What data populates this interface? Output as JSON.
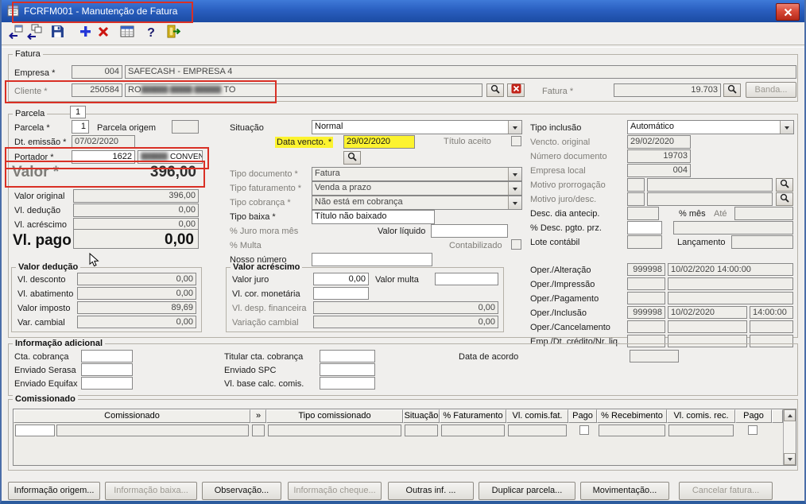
{
  "window": {
    "title": "FCRFM001 - Manutenção de Fatura"
  },
  "fatura": {
    "legend": "Fatura",
    "empresa_label": "Empresa *",
    "empresa_code": "004",
    "empresa_name": "SAFECASH -  EMPRESA 4",
    "cliente_label": "Cliente *",
    "cliente_code": "250584",
    "cliente_name_start": "RO",
    "cliente_name_redacted": "██████ █████ ██████",
    "cliente_name_end": "TO",
    "fatura_label": "Fatura *",
    "fatura_value": "19.703",
    "banda_button": "Banda..."
  },
  "parcela": {
    "legend": "Parcela",
    "tab": "1",
    "parcela_label": "Parcela *",
    "parcela_value": "1",
    "parcela_origem_label": "Parcela origem",
    "dt_emissao_label": "Dt. emissão *",
    "dt_emissao_value": "07/02/2020",
    "portador_label": "Portador *",
    "portador_code": "1622",
    "portador_redacted": "██████",
    "portador_name": "CONVENIO",
    "valor_label": "Valor *",
    "valor_value": "396,00",
    "valor_original_label": "Valor original",
    "valor_original_value": "396,00",
    "vl_deducao_label": "Vl. dedução",
    "vl_deducao_value": "0,00",
    "vl_acrescimo_label": "Vl. acréscimo",
    "vl_acrescimo_value": "0,00",
    "vl_pago_label": "Vl. pago",
    "vl_pago_value": "0,00",
    "situacao_label": "Situação",
    "situacao_value": "Normal",
    "data_vencto_label": "Data vencto. *",
    "data_vencto_value": "29/02/2020",
    "titulo_aceito_label": "Título aceito",
    "tipo_documento_label": "Tipo documento *",
    "tipo_documento_value": "Fatura",
    "tipo_faturamento_label": "Tipo faturamento *",
    "tipo_faturamento_value": "Venda a prazo",
    "tipo_cobranca_label": "Tipo cobrança *",
    "tipo_cobranca_value": "Não está em cobrança",
    "tipo_baixa_label": "Tipo baixa *",
    "tipo_baixa_value": "Título não baixado",
    "juro_mora_label": "% Juro mora mês",
    "valor_liquido_label": "Valor líquido",
    "multa_label": "% Multa",
    "contabilizado_label": "Contabilizado",
    "nosso_numero_label": "Nosso número",
    "tipo_inclusao_label": "Tipo inclusão",
    "tipo_inclusao_value": "Automático",
    "vencto_original_label": "Vencto. original",
    "vencto_original_value": "29/02/2020",
    "numero_documento_label": "Número documento",
    "numero_documento_value": "19703",
    "empresa_local_label": "Empresa local",
    "empresa_local_value": "004",
    "motivo_prorrogacao_label": "Motivo prorrogação",
    "motivo_juro_label": "Motivo juro/desc.",
    "desc_dia_label": "Desc. dia antecip.",
    "pct_mes_label": "% mês",
    "ate_label": "Até",
    "desc_pgto_label": "% Desc. pgto. prz.",
    "lote_label": "Lote contábil",
    "lancamento_label": "Lançamento"
  },
  "valores": {
    "deducao_legend": "Valor dedução",
    "vl_desconto_label": "Vl. desconto",
    "vl_desconto_value": "0,00",
    "vl_abatimento_label": "Vl. abatimento",
    "vl_abatimento_value": "0,00",
    "valor_imposto_label": "Valor imposto",
    "valor_imposto_value": "89,69",
    "var_cambial_label": "Var. cambial",
    "var_cambial_value": "0,00",
    "acrescimo_legend": "Valor acréscimo",
    "valor_juro_label": "Valor juro",
    "valor_juro_value": "0,00",
    "valor_multa_label": "Valor multa",
    "vl_cor_label": "Vl. cor. monetária",
    "vl_desp_label": "Vl. desp. financeira",
    "vl_desp_value": "0,00",
    "variacao_cambial_label": "Variação cambial",
    "variacao_cambial_value": "0,00"
  },
  "oper": {
    "alteracao_label": "Oper./Alteração",
    "alteracao_user": "999998",
    "alteracao_dt": "10/02/2020 14:00:00",
    "impressao_label": "Oper./Impressão",
    "pagamento_label": "Oper./Pagamento",
    "inclusao_label": "Oper./Inclusão",
    "inclusao_user": "999998",
    "inclusao_date": "10/02/2020",
    "inclusao_time": "14:00:00",
    "cancelamento_label": "Oper./Cancelamento",
    "emp_credito_label": "Emp./Dt. crédito/Nr. liq."
  },
  "info_adicional": {
    "legend": "Informação adicional",
    "cta_cobranca_label": "Cta. cobrança",
    "enviado_serasa_label": "Enviado Serasa",
    "enviado_equifax_label": "Enviado Equifax",
    "titular_label": "Titular cta. cobrança",
    "enviado_spc_label": "Enviado SPC",
    "vl_base_label": "Vl. base calc. comis.",
    "data_acordo_label": "Data de acordo"
  },
  "comissionado": {
    "legend": "Comissionado",
    "headers": [
      "Comissionado",
      "»",
      "Tipo comissionado",
      "Situação",
      "% Faturamento",
      "Vl. comis.fat.",
      "Pago",
      "% Recebimento",
      "Vl. comis. rec.",
      "Pago"
    ]
  },
  "footer_buttons": [
    {
      "label": "Informação origem...",
      "disabled": false
    },
    {
      "label": "Informação baixa...",
      "disabled": true
    },
    {
      "label": "Observação...",
      "disabled": false
    },
    {
      "label": "Informação cheque...",
      "disabled": true
    },
    {
      "label": "Outras inf. ...",
      "disabled": false
    },
    {
      "label": "Duplicar parcela...",
      "disabled": false
    },
    {
      "label": "Movimentação...",
      "disabled": false
    },
    {
      "label": "Cancelar fatura...",
      "disabled": true
    }
  ]
}
